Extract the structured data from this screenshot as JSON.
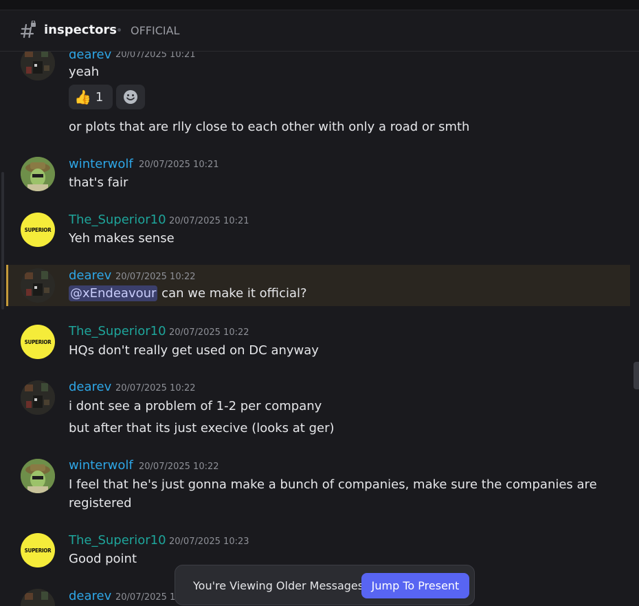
{
  "channel": {
    "name": "inspectors",
    "topic": "OFFICIAL"
  },
  "messages": [
    {
      "author": "dearev",
      "timestamp": "20/07/2025 10:21",
      "lines": [
        "yeah"
      ]
    },
    {
      "author": "",
      "timestamp": "",
      "lines": [
        "or plots that are rlly close to each other with only a road or smth"
      ]
    },
    {
      "author": "winterwolf",
      "timestamp": "20/07/2025 10:21",
      "lines": [
        "that's fair"
      ]
    },
    {
      "author": "The_Superior10",
      "timestamp": "20/07/2025 10:21",
      "lines": [
        "Yeh makes sense"
      ],
      "avatar_text": "SUPERIOR"
    },
    {
      "author": "dearev",
      "timestamp": "20/07/2025 10:22",
      "mention": "@xEndeavour",
      "lines": [
        "can we make it official?"
      ]
    },
    {
      "author": "The_Superior10",
      "timestamp": "20/07/2025 10:22",
      "lines": [
        "HQs don't really get used on DC anyway"
      ],
      "avatar_text": "SUPERIOR"
    },
    {
      "author": "dearev",
      "timestamp": "20/07/2025 10:22",
      "lines": [
        "i dont see a problem of 1-2 per company",
        "but after that its just execive (looks at ger)"
      ]
    },
    {
      "author": "winterwolf",
      "timestamp": "20/07/2025 10:22",
      "lines": [
        "I feel that he's just gonna make a bunch of companies, make sure the companies are",
        "registered"
      ]
    },
    {
      "author": "The_Superior10",
      "timestamp": "20/07/2025 10:23",
      "lines": [
        "Good point"
      ],
      "avatar_text": "SUPERIOR"
    },
    {
      "author": "dearev",
      "timestamp": "20/07/2025 1",
      "lines": []
    }
  ],
  "reaction": {
    "emoji": "👍",
    "count": "1"
  },
  "banner": {
    "text": "You're Viewing Older Messages",
    "button": "Jump To Present"
  },
  "colors": {
    "accent": "#5865f2",
    "username_blue": "#2ea6e6",
    "username_teal": "#1ea59b",
    "highlight_bar": "#c49a3a"
  }
}
